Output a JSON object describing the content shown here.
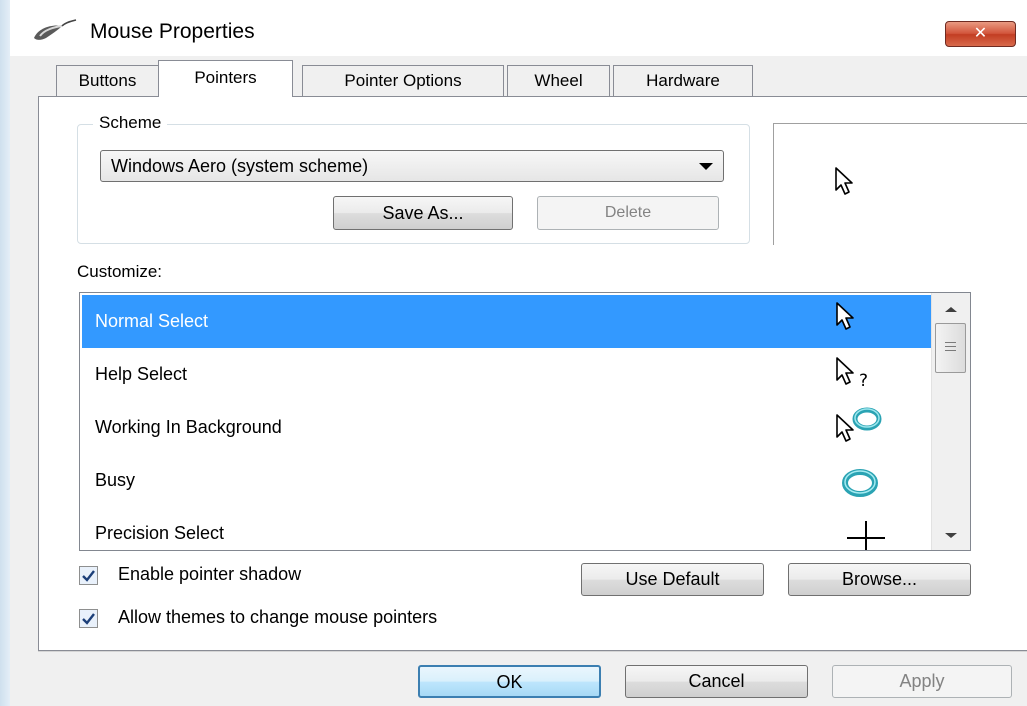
{
  "window": {
    "title": "Mouse Properties",
    "close_glyph": "✕",
    "close_color": "#c7432a"
  },
  "tabs": [
    {
      "label": "Buttons",
      "active": false
    },
    {
      "label": "Pointers",
      "active": true
    },
    {
      "label": "Pointer Options",
      "active": false
    },
    {
      "label": "Wheel",
      "active": false
    },
    {
      "label": "Hardware",
      "active": false
    }
  ],
  "scheme": {
    "group_label": "Scheme",
    "selected": "Windows Aero (system scheme)",
    "save_as_label": "Save As...",
    "delete_label": "Delete",
    "delete_enabled": false
  },
  "preview": {
    "cursor_icon": "arrow-cursor-icon"
  },
  "customize": {
    "label": "Customize:",
    "selection_color": "#3399ff",
    "rows": [
      {
        "label": "Normal Select",
        "icon": "arrow-cursor-icon",
        "selected": true
      },
      {
        "label": "Help Select",
        "icon": "help-cursor-icon",
        "selected": false
      },
      {
        "label": "Working In Background",
        "icon": "working-cursor-icon",
        "selected": false
      },
      {
        "label": "Busy",
        "icon": "busy-cursor-icon",
        "selected": false
      },
      {
        "label": "Precision Select",
        "icon": "crosshair-cursor-icon",
        "selected": false
      }
    ]
  },
  "options": {
    "enable_shadow_label": "Enable pointer shadow",
    "enable_shadow_checked": true,
    "allow_themes_label": "Allow themes to change mouse pointers",
    "allow_themes_checked": true,
    "use_default_label": "Use Default",
    "browse_label": "Browse..."
  },
  "footer": {
    "ok_label": "OK",
    "cancel_label": "Cancel",
    "apply_label": "Apply",
    "apply_enabled": false
  }
}
